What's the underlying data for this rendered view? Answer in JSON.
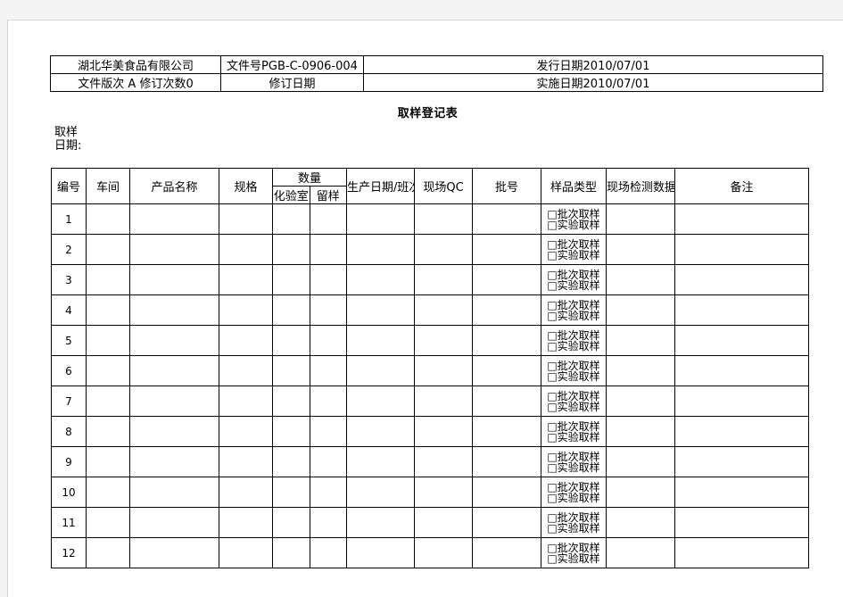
{
  "document": {
    "title": "取样登记表",
    "sampling_date_label": "取样日期:"
  },
  "header_info": {
    "company": "湖北华美食品有限公司",
    "doc_number": "文件号PGB-C-0906-004",
    "issue_date": "发行日期2010/07/01",
    "version": "文件版次 A   修订次数0",
    "revision_date": "修订日期",
    "effective_date": "实施日期2010/07/01"
  },
  "table": {
    "columns": [
      {
        "key": "idx",
        "label": "编号"
      },
      {
        "key": "work",
        "label": "车间"
      },
      {
        "key": "prod",
        "label": "产品名称"
      },
      {
        "key": "spec",
        "label": "规格"
      },
      {
        "key": "qty",
        "label": "数量",
        "sub": [
          "化验室",
          "留样"
        ]
      },
      {
        "key": "date",
        "label": "生产日期/班次"
      },
      {
        "key": "qc",
        "label": "现场QC"
      },
      {
        "key": "lot",
        "label": "批号"
      },
      {
        "key": "type",
        "label": "样品类型"
      },
      {
        "key": "meas",
        "label": "现场检测数据"
      },
      {
        "key": "note",
        "label": "备注"
      }
    ],
    "sample_type_options": [
      "□批次取样",
      "□实验取样"
    ],
    "rows": [
      {
        "idx": "1",
        "work": "",
        "prod": "",
        "spec": "",
        "lab": "",
        "keep": "",
        "date": "",
        "qc": "",
        "lot": "",
        "meas": "",
        "note": ""
      },
      {
        "idx": "2",
        "work": "",
        "prod": "",
        "spec": "",
        "lab": "",
        "keep": "",
        "date": "",
        "qc": "",
        "lot": "",
        "meas": "",
        "note": ""
      },
      {
        "idx": "3",
        "work": "",
        "prod": "",
        "spec": "",
        "lab": "",
        "keep": "",
        "date": "",
        "qc": "",
        "lot": "",
        "meas": "",
        "note": ""
      },
      {
        "idx": "4",
        "work": "",
        "prod": "",
        "spec": "",
        "lab": "",
        "keep": "",
        "date": "",
        "qc": "",
        "lot": "",
        "meas": "",
        "note": ""
      },
      {
        "idx": "5",
        "work": "",
        "prod": "",
        "spec": "",
        "lab": "",
        "keep": "",
        "date": "",
        "qc": "",
        "lot": "",
        "meas": "",
        "note": ""
      },
      {
        "idx": "6",
        "work": "",
        "prod": "",
        "spec": "",
        "lab": "",
        "keep": "",
        "date": "",
        "qc": "",
        "lot": "",
        "meas": "",
        "note": ""
      },
      {
        "idx": "7",
        "work": "",
        "prod": "",
        "spec": "",
        "lab": "",
        "keep": "",
        "date": "",
        "qc": "",
        "lot": "",
        "meas": "",
        "note": ""
      },
      {
        "idx": "8",
        "work": "",
        "prod": "",
        "spec": "",
        "lab": "",
        "keep": "",
        "date": "",
        "qc": "",
        "lot": "",
        "meas": "",
        "note": ""
      },
      {
        "idx": "9",
        "work": "",
        "prod": "",
        "spec": "",
        "lab": "",
        "keep": "",
        "date": "",
        "qc": "",
        "lot": "",
        "meas": "",
        "note": ""
      },
      {
        "idx": "10",
        "work": "",
        "prod": "",
        "spec": "",
        "lab": "",
        "keep": "",
        "date": "",
        "qc": "",
        "lot": "",
        "meas": "",
        "note": ""
      },
      {
        "idx": "11",
        "work": "",
        "prod": "",
        "spec": "",
        "lab": "",
        "keep": "",
        "date": "",
        "qc": "",
        "lot": "",
        "meas": "",
        "note": ""
      },
      {
        "idx": "12",
        "work": "",
        "prod": "",
        "spec": "",
        "lab": "",
        "keep": "",
        "date": "",
        "qc": "",
        "lot": "",
        "meas": "",
        "note": ""
      }
    ]
  }
}
